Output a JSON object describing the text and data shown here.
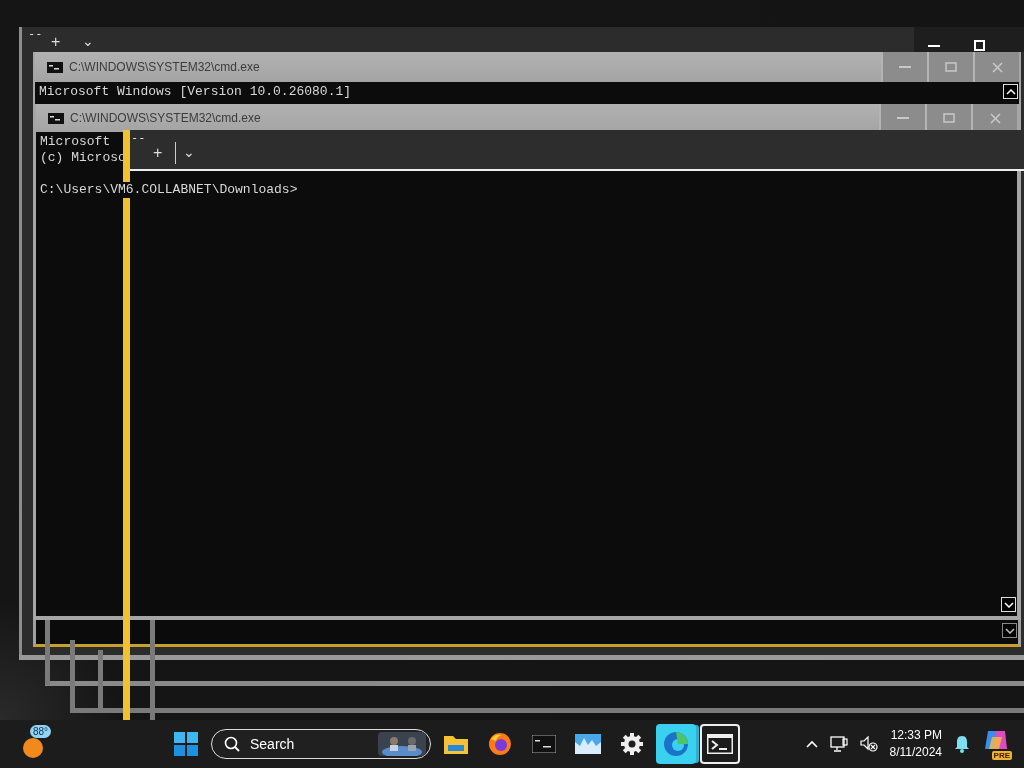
{
  "background_terminal": {
    "corner_mark": "--",
    "new_tab": "+",
    "dropdown": "⌄"
  },
  "console_windows": [
    {
      "title": "C:\\WINDOWS\\SYSTEM32\\cmd.exe",
      "lines": [
        "Microsoft Windows [Version 10.0.26080.1]"
      ]
    },
    {
      "title": "C:\\WINDOWS\\SYSTEM32\\cmd.exe",
      "lines": [
        "Microsoft",
        "(c) Microso"
      ],
      "prompt": "C:\\Users\\VM6.COLLABNET\\Downloads>"
    }
  ],
  "front_terminal": {
    "corner_mark": "--",
    "new_tab": "+",
    "dropdown": "⌄"
  },
  "taskbar": {
    "weather": {
      "temperature": "88°"
    },
    "search": {
      "placeholder": "Search"
    },
    "apps": [
      {
        "kind": "files",
        "selected": false,
        "highlighted": false
      },
      {
        "kind": "browser",
        "selected": false,
        "highlighted": false
      },
      {
        "kind": "console",
        "selected": false,
        "highlighted": false
      },
      {
        "kind": "monitor",
        "selected": false,
        "highlighted": false
      },
      {
        "kind": "settings",
        "selected": false,
        "highlighted": false
      },
      {
        "kind": "edge",
        "selected": false,
        "highlighted": true
      },
      {
        "kind": "terminal",
        "selected": true,
        "highlighted": false
      }
    ],
    "clock": {
      "time": "12:33 PM",
      "date": "8/11/2024"
    },
    "copilot_badge": "PRE"
  }
}
